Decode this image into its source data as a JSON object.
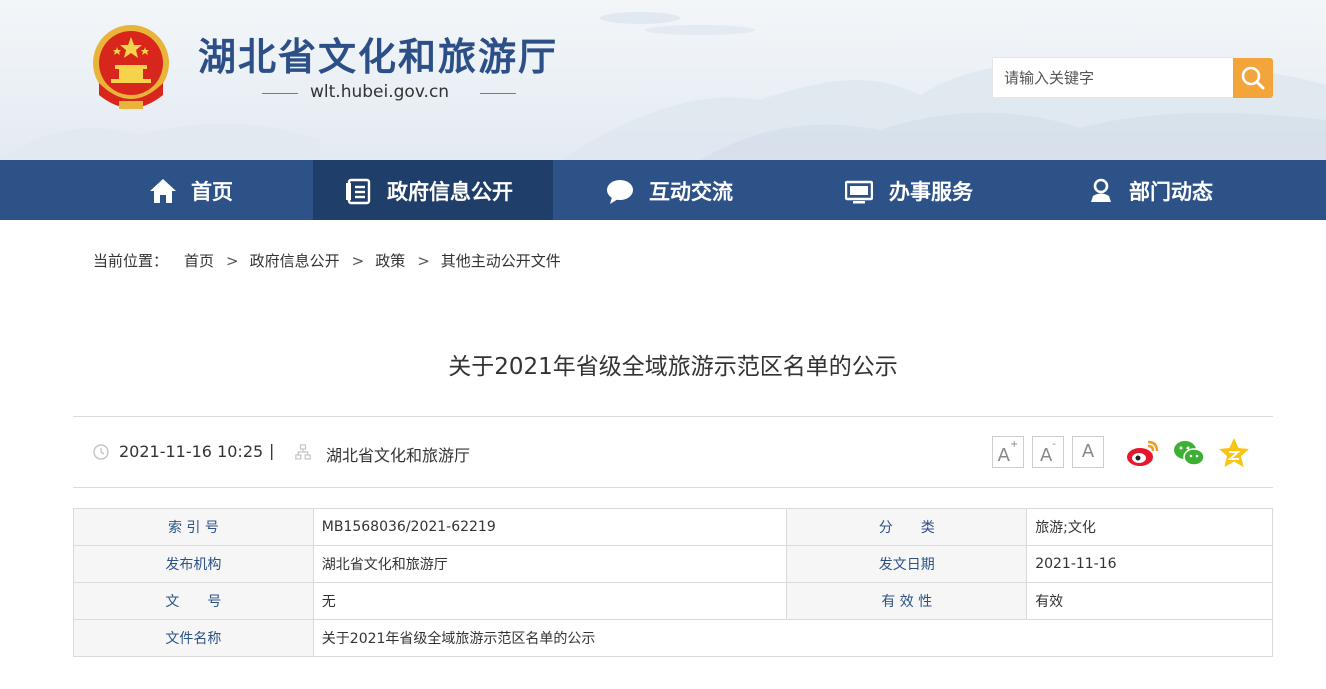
{
  "header": {
    "site_title": "湖北省文化和旅游厅",
    "site_url": "wlt.hubei.gov.cn",
    "search_placeholder": "请输入关键字"
  },
  "nav": {
    "items": [
      {
        "label": "首页",
        "icon": "home-icon"
      },
      {
        "label": "政府信息公开",
        "icon": "document-list-icon",
        "active": true
      },
      {
        "label": "互动交流",
        "icon": "chat-bubble-icon"
      },
      {
        "label": "办事服务",
        "icon": "monitor-icon"
      },
      {
        "label": "部门动态",
        "icon": "location-person-icon"
      }
    ]
  },
  "breadcrumb": {
    "label": "当前位置：",
    "items": [
      "首页",
      "政府信息公开",
      "政策",
      "其他主动公开文件"
    ],
    "separator": ">"
  },
  "article": {
    "title": "关于2021年省级全域旅游示范区名单的公示",
    "datetime": "2021-11-16 10:25",
    "divider": "|",
    "source": "湖北省文化和旅游厅"
  },
  "font_controls": [
    {
      "label": "A",
      "modifier": "+"
    },
    {
      "label": "A",
      "modifier": "-"
    },
    {
      "label": "A",
      "modifier": ""
    }
  ],
  "share": [
    "weibo-icon",
    "wechat-icon",
    "qzone-icon"
  ],
  "info_table": {
    "rows": [
      [
        {
          "k": "索 引 号",
          "v": "MB1568036/2021-62219"
        },
        {
          "k": "分　　类",
          "v": "旅游;文化"
        }
      ],
      [
        {
          "k": "发布机构",
          "v": "湖北省文化和旅游厅"
        },
        {
          "k": "发文日期",
          "v": "2021-11-16"
        }
      ],
      [
        {
          "k": "文　　号",
          "v": "无"
        },
        {
          "k": "有 效 性",
          "v": "有效"
        }
      ],
      [
        {
          "k": "文件名称",
          "v": "关于2021年省级全域旅游示范区名单的公示"
        }
      ]
    ]
  },
  "colors": {
    "nav_bg": "#2d5287",
    "nav_active_bg": "#203e6a",
    "title_blue": "#2b4f86",
    "search_button": "#f3a43a",
    "table_key_text": "#2d5287"
  }
}
